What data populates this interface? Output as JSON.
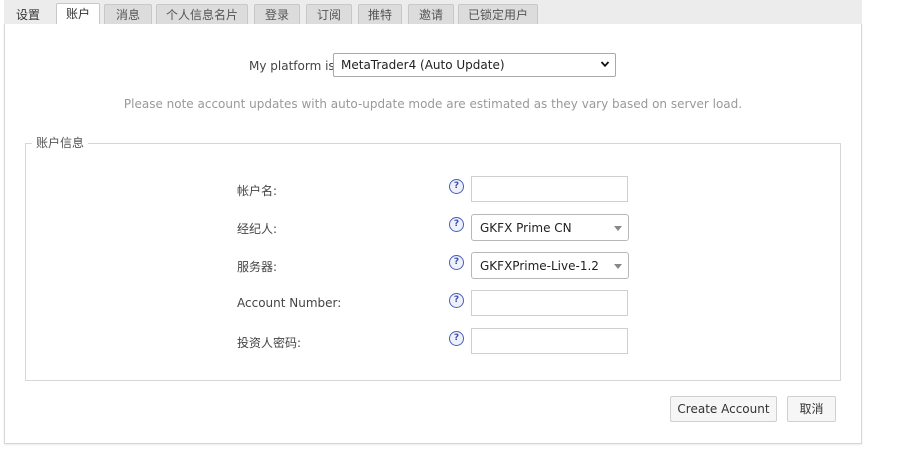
{
  "tabs": [
    "设置",
    "账户",
    "消息",
    "个人信息名片",
    "登录",
    "订阅",
    "推特",
    "邀请",
    "已锁定用户"
  ],
  "platform": {
    "label": "My platform is:",
    "selected": "MetaTrader4 (Auto Update)"
  },
  "note": "Please note account updates with auto-update mode are estimated as they vary based on server load.",
  "account_info": {
    "legend": "账户信息",
    "fields": {
      "account_name": {
        "label": "帐户名:",
        "value": ""
      },
      "broker": {
        "label": "经纪人:",
        "value": "GKFX Prime CN"
      },
      "server": {
        "label": "服务器:",
        "value": "GKFXPrime-Live-1.2"
      },
      "account_number": {
        "label": "Account Number:",
        "value": ""
      },
      "investor_password": {
        "label": "投资人密码:",
        "value": ""
      }
    }
  },
  "buttons": {
    "create": "Create Account",
    "cancel": "取消"
  },
  "colors": {
    "tab_bar": "#ececec",
    "help_icon": "#3d4fb0",
    "note_text": "#999999"
  }
}
